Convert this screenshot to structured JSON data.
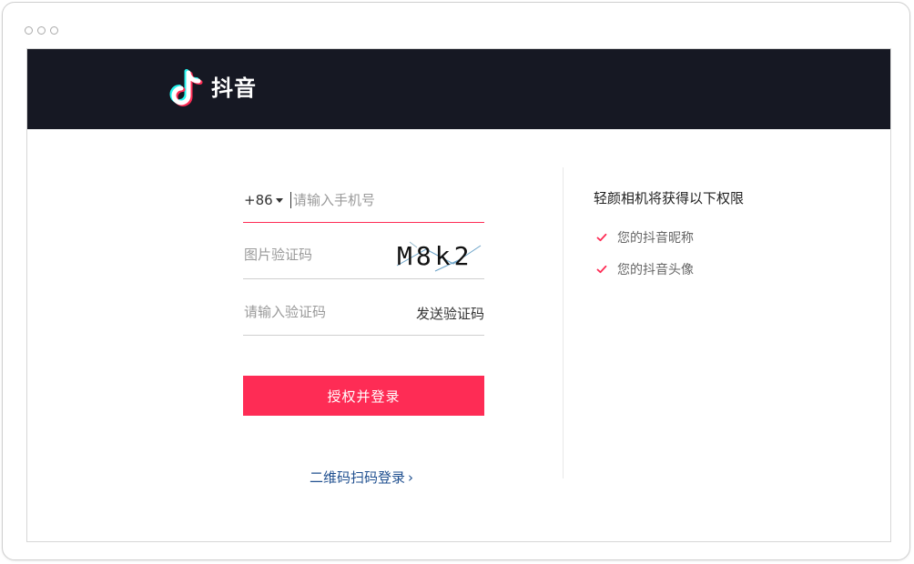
{
  "header": {
    "app_name": "抖音",
    "logo_icon": "tiktok-note-icon"
  },
  "colors": {
    "header_bg": "#161823",
    "accent": "#fe2c55",
    "link": "#1f4f8f"
  },
  "form": {
    "country_code": "+86",
    "phone_placeholder": "请输入手机号",
    "captcha_placeholder": "图片验证码",
    "captcha_text": "M8k2",
    "sms_placeholder": "请输入验证码",
    "send_code_label": "发送验证码",
    "submit_label": "授权并登录",
    "qr_login_label": "二维码扫码登录"
  },
  "permissions": {
    "title": "轻颜相机将获得以下权限",
    "items": [
      {
        "label": "您的抖音昵称"
      },
      {
        "label": "您的抖音头像"
      }
    ]
  }
}
